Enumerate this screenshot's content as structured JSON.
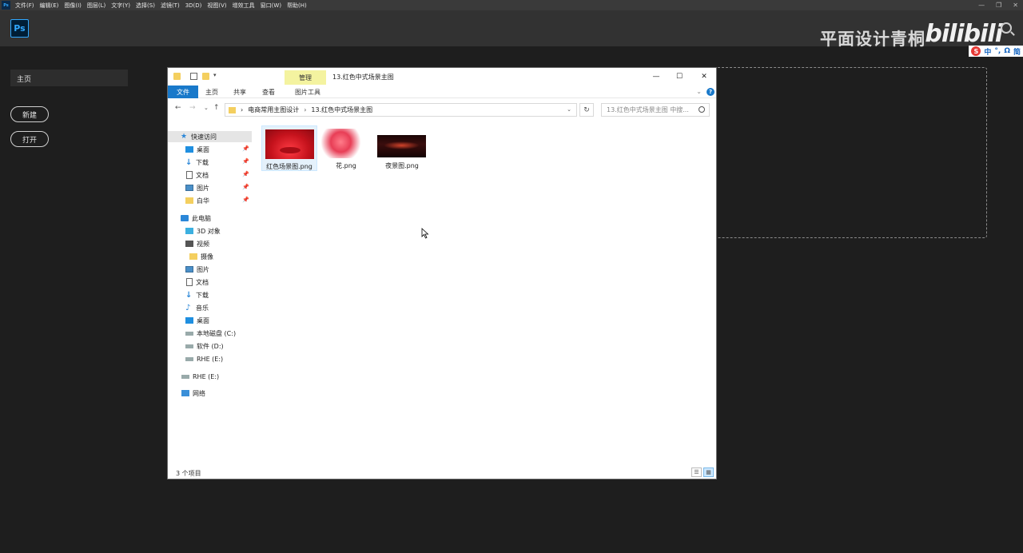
{
  "ps": {
    "menu": [
      "文件(F)",
      "编辑(E)",
      "图像(I)",
      "图层(L)",
      "文字(Y)",
      "选择(S)",
      "滤镜(T)",
      "3D(D)",
      "视图(V)",
      "增效工具",
      "窗口(W)",
      "帮助(H)"
    ],
    "logo": "Ps",
    "mini_logo": "Ps",
    "watermark": "平面设计青桐",
    "bili": "bilibili",
    "ime": {
      "s": "S",
      "zh": "中",
      "dot": "°,",
      "omega": "Ω",
      "jian": "简"
    },
    "home_label": "主页",
    "new_label": "新建",
    "open_label": "打开"
  },
  "explorer": {
    "context_tab": "管理",
    "title": "13.红色中式场景主图",
    "ribbon": {
      "file": "文件",
      "home": "主页",
      "share": "共享",
      "view": "查看",
      "picture_tools": "图片工具"
    },
    "address": {
      "part1": "电商常用主图设计",
      "part2": "13.红色中式场景主图"
    },
    "search_placeholder": "13.红色中式场景主图 中搜...",
    "nav": {
      "quick_access": "快速访问",
      "desktop": "桌面",
      "downloads": "下载",
      "documents": "文档",
      "pictures": "图片",
      "baihua": "白华",
      "this_pc": "此电脑",
      "objects3d": "3D 对象",
      "videos": "视频",
      "camera": "摄像",
      "pictures2": "图片",
      "documents2": "文档",
      "downloads2": "下载",
      "music": "音乐",
      "desktop2": "桌面",
      "drive_c": "本地磁盘 (C:)",
      "drive_d": "软件 (D:)",
      "drive_e": "RHE (E:)",
      "drive_e2": "RHE (E:)",
      "network": "网络"
    },
    "files": [
      {
        "name": "红色场景图.png"
      },
      {
        "name": "花.png"
      },
      {
        "name": "夜景图.png"
      }
    ],
    "status": "3 个项目"
  }
}
